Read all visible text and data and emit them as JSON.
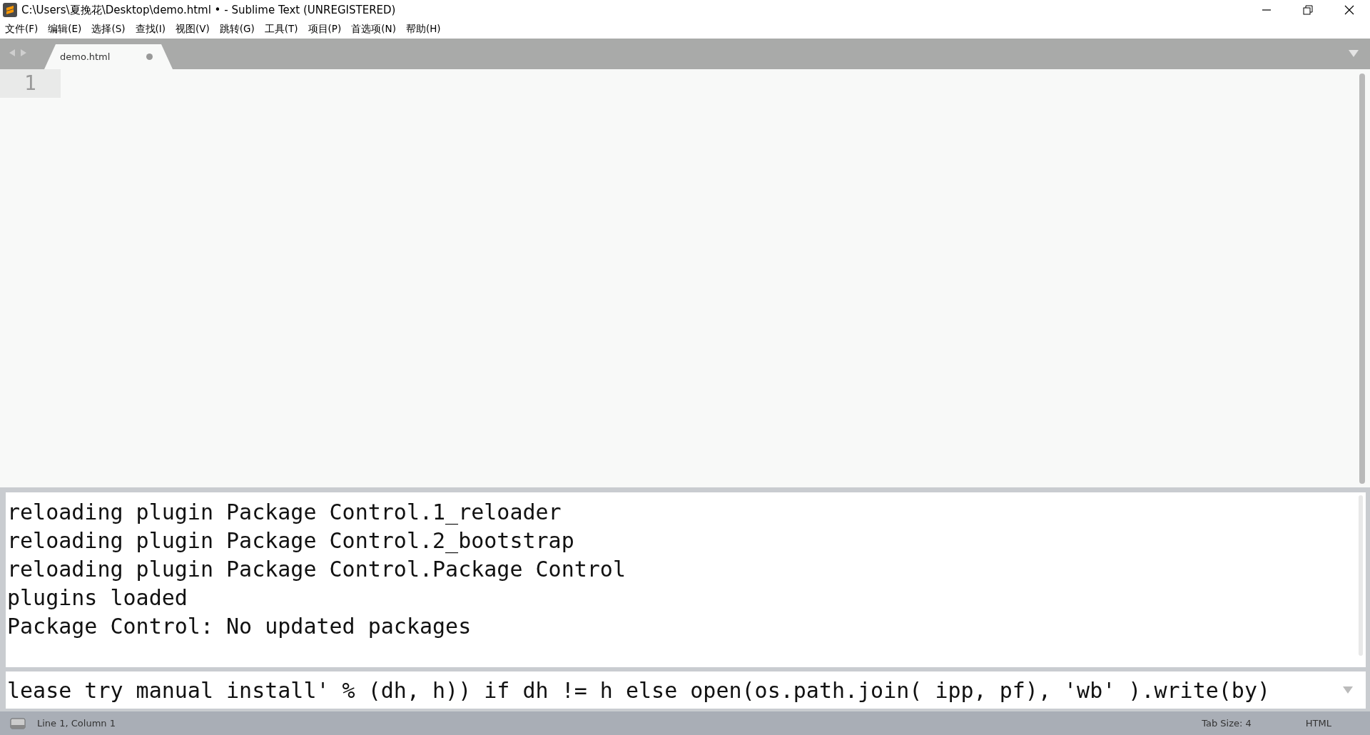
{
  "window": {
    "title": "C:\\Users\\夏挽花\\Desktop\\demo.html • - Sublime Text (UNREGISTERED)"
  },
  "menu": [
    "文件(F)",
    "编辑(E)",
    "选择(S)",
    "查找(I)",
    "视图(V)",
    "跳转(G)",
    "工具(T)",
    "项目(P)",
    "首选项(N)",
    "帮助(H)"
  ],
  "tabs": [
    {
      "label": "demo.html",
      "selected": true,
      "modified": true
    }
  ],
  "editor": {
    "line_numbers": [
      "1"
    ]
  },
  "console": {
    "lines": [
      "reloading plugin Package Control.1_reloader",
      "reloading plugin Package Control.2_bootstrap",
      "reloading plugin Package Control.Package Control",
      "plugins loaded",
      "Package Control: No updated packages"
    ],
    "input": "lease try manual install' % (dh, h)) if dh != h else open(os.path.join( ipp, pf), 'wb' ).write(by)"
  },
  "status_bar": {
    "position": "Line 1, Column 1",
    "tab_size": "Tab Size: 4",
    "syntax": "HTML"
  }
}
